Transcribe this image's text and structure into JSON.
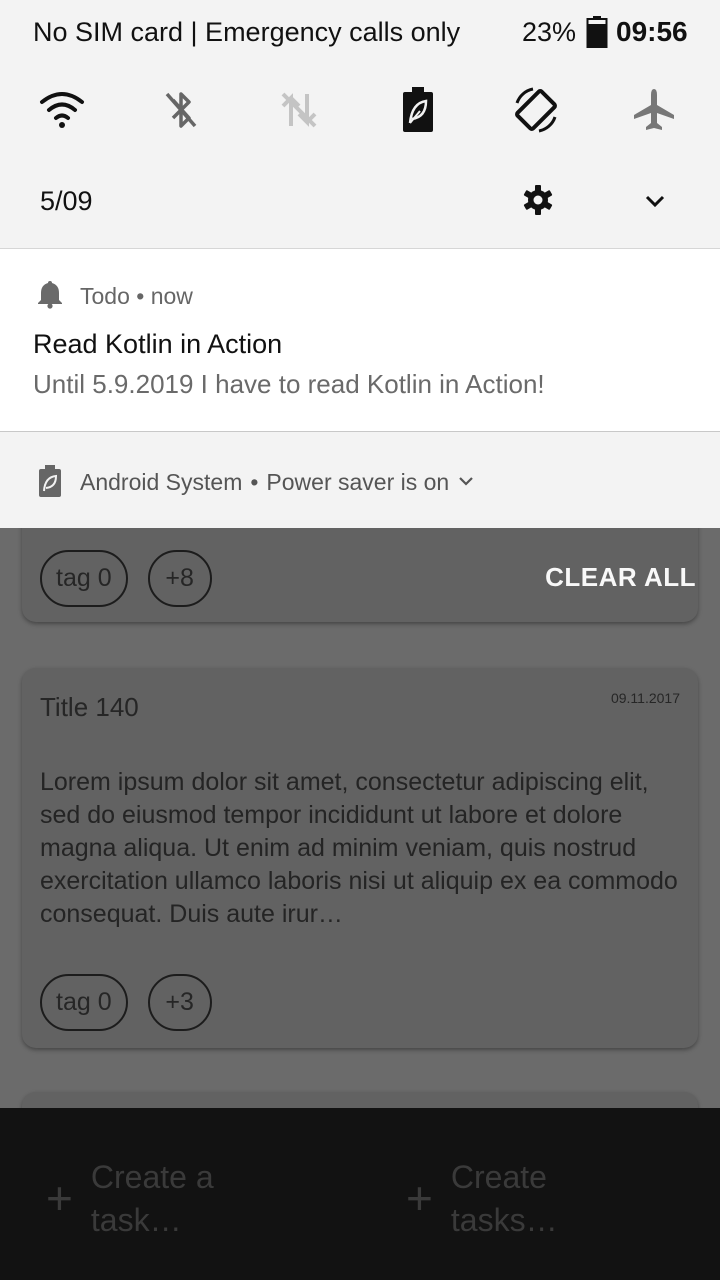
{
  "status_bar": {
    "carrier": "No SIM card | Emergency calls only",
    "battery_percent": "23%",
    "time": "09:56"
  },
  "quick_settings": {
    "tiles": [
      "wifi-icon",
      "bluetooth-off-icon",
      "mobile-data-off-icon",
      "power-saver-icon",
      "auto-rotate-icon",
      "airplane-mode-icon"
    ],
    "date": "5/09"
  },
  "notifications": {
    "todo": {
      "app": "Todo",
      "time": "now",
      "title": "Read Kotlin in Action",
      "text": "Until 5.9.2019 I have to read Kotlin in Action!"
    },
    "system": {
      "app": "Android System",
      "text": "Power saver is on"
    },
    "clear_all": "CLEAR ALL"
  },
  "app": {
    "cards": [
      {
        "tags": [
          "tag 0",
          "+8"
        ]
      },
      {
        "title": "Title 140",
        "date": "09.11.2017",
        "body": "Lorem ipsum dolor sit amet, consectetur adipiscing elit, sed do eiusmod tempor incididunt ut labore et dolore magna aliqua. Ut enim ad minim veniam, quis nostrud exercitation ullamco laboris nisi ut aliquip ex ea commodo consequat. Duis aute irur…",
        "tags": [
          "tag 0",
          "+3"
        ]
      }
    ],
    "bottom_bar": {
      "create_task": "Create a task…",
      "create_tasks": "Create tasks…"
    }
  },
  "colors": {
    "shade_bg": "#f3f3f3",
    "notification_bg": "#ffffff",
    "scrim": "#6b6b6b",
    "bottom_bar": "#121212"
  }
}
